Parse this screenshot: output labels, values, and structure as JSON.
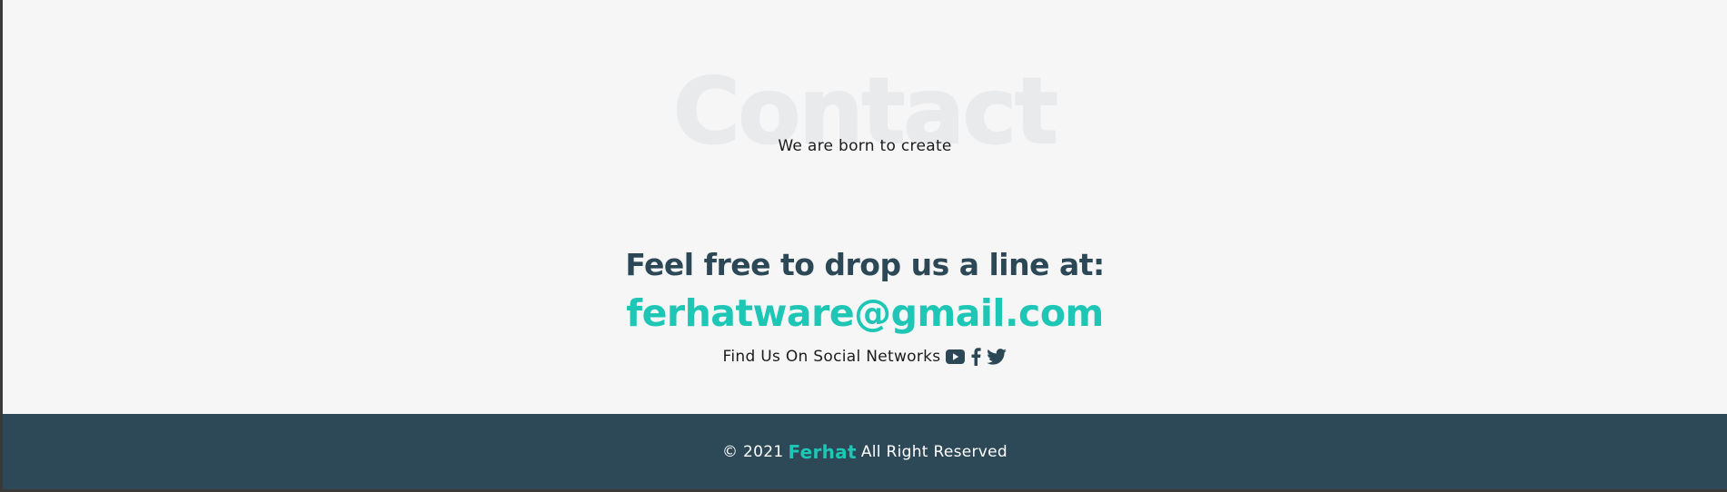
{
  "contact": {
    "background_title": "Contact",
    "subtitle": "We are born to create",
    "headline": "Feel free to drop us a line at:",
    "email": "ferhatware@gmail.com",
    "social_label": "Find Us On Social Networks",
    "social_icons": [
      "youtube-icon",
      "facebook-icon",
      "twitter-icon"
    ]
  },
  "footer": {
    "copyright_prefix": "© 2021",
    "brand": "Ferhat",
    "rights": "All Right Reserved"
  },
  "colors": {
    "accent": "#1ec6b6",
    "dark": "#2d4957",
    "background": "#f6f6f6"
  }
}
